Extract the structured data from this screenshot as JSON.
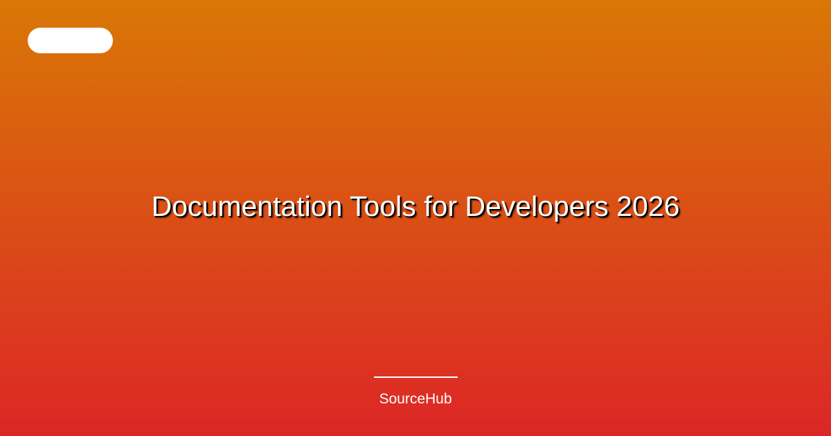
{
  "page": {
    "title": "Documentation Tools for Developers 2026",
    "brand": "SourceHub"
  },
  "colors": {
    "gradient_top": "#d97706",
    "gradient_bottom": "#dc2626",
    "text": "#ffffff",
    "badge": "#ffffff"
  }
}
